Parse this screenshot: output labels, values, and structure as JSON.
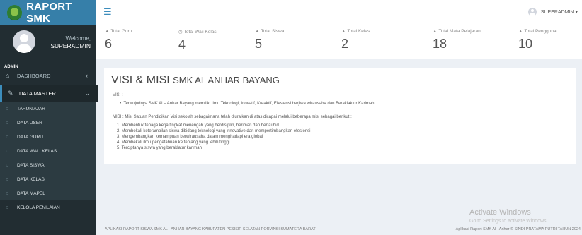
{
  "brand": {
    "name": "RAPORT SMK",
    "accent": "#367fa9"
  },
  "user": {
    "welcome": "Welcome,",
    "name": "SUPERADMIN",
    "role": "ADMIN"
  },
  "sidebar": {
    "dashboard": {
      "icon": "home-icon",
      "label": "DASHBOARD"
    },
    "data_master": {
      "icon": "edit-icon",
      "label": "DATA MASTER"
    },
    "sub_items": [
      "TAHUN AJAR",
      "DATA USER",
      "DATA GURU",
      "DATA WALI KELAS",
      "DATA SISWA",
      "DATA KELAS",
      "DATA MAPEL",
      "KELOLA PENILAIAN"
    ]
  },
  "topbar": {
    "menu_icon": "hamburger-icon",
    "username": "SUPERADMIN"
  },
  "stats": [
    {
      "icon": "user-icon",
      "label": "Total Guru",
      "value": "6"
    },
    {
      "icon": "clock-icon",
      "label": "Total Wali Kelas",
      "value": "4"
    },
    {
      "icon": "user-icon",
      "label": "Total Siswa",
      "value": "5"
    },
    {
      "icon": "user-icon",
      "label": "Total Kelas",
      "value": "2"
    },
    {
      "icon": "user-icon",
      "label": "Total Mata Pelajaran",
      "value": "18"
    },
    {
      "icon": "user-icon",
      "label": "Total Pengguna",
      "value": "10"
    }
  ],
  "content": {
    "title_main": "VISI & MISI",
    "title_small": "SMK AL ANHAR BAYANG",
    "visi_label": "VISI :",
    "visi_text": "Terwujudnya SMK Al – Anhar Bayang memiliki Ilmu Teknologi, Inovatif, Kreaktif, Efesiensi berjiwa wirausaha dan Beraklaktur Karimah",
    "misi_intro": "MISI : Misi Satuan Pendidikan Visi sekolah sebagaimana telah diuraikan di atas dicapai melalui beberapa misi sebagai berikut :",
    "misi_items": [
      "1. Membentuk tenaga kerja tingkat menengah yang berdisiplin, beriman dan bertauhid",
      "2. Membekali keterampilan siswa dibidang teknologi yang innovative dan mempertimbangkan efesiensi",
      "3. Mengembangkan kemampuan berwirausaha dalam menghadapi era global",
      "4. Membekali ilmu pengetahuan ke tenjang yang lebih tinggi",
      "5. Terciptanya siswa yang beraklatur karimah"
    ]
  },
  "watermark": {
    "line1": "Activate Windows",
    "line2": "Go to Settings to activate Windows."
  },
  "footer": {
    "left": "APLIKASI RAPORT SISWA SMK AL - ANHAR BAYANG KABUPATEN PESISIR SELATAN PORVINSI SUMATERA BARAT",
    "right": "Aplikasi Raport SMK Al - Anhar © SINDI PRATAMA PUTRI TAHUN 2024"
  }
}
